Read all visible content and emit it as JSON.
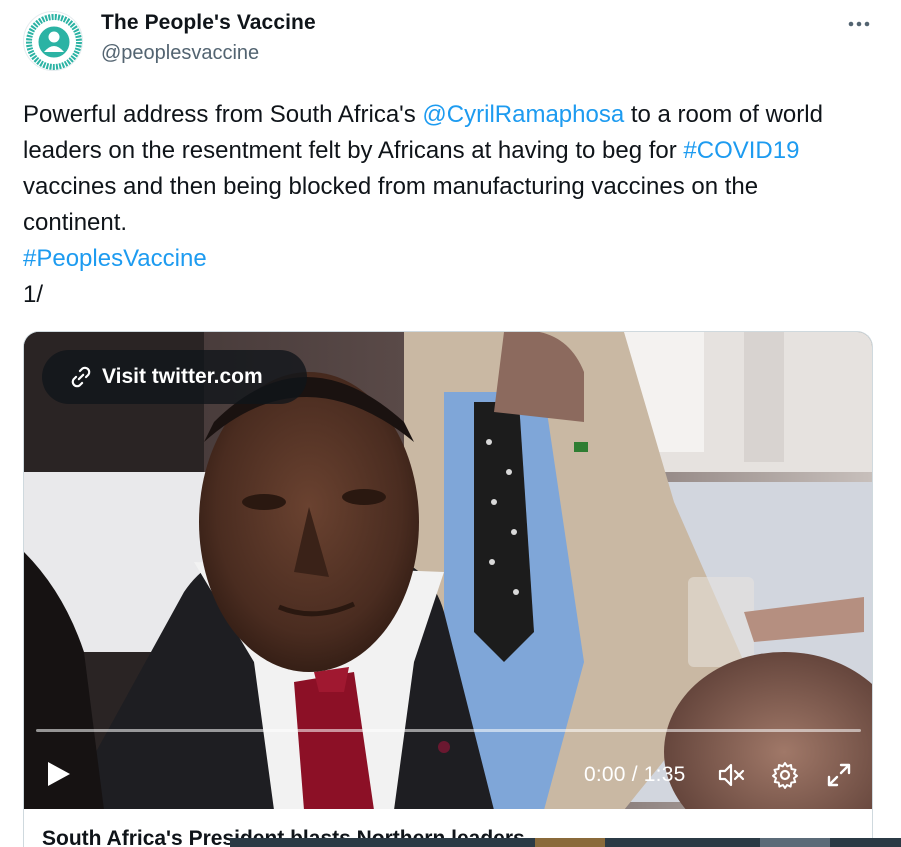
{
  "author": {
    "display_name": "The People's Vaccine",
    "handle": "@peoplesvaccine",
    "avatar_icon": "peoples-vaccine-logo-icon",
    "avatar_ring_text": "#PEOPLESVACCINE NOT A PROFIT VACCINE"
  },
  "more_icon": "more-horizontal-icon",
  "tweet": {
    "text_1": "Powerful address from South Africa's ",
    "mention": "@CyrilRamaphosa",
    "text_2": " to a room of world leaders on the resentment felt by Africans at having to beg for ",
    "hashtag_1": "#COVID19",
    "text_3": " vaccines and then being blocked from manufacturing vaccines on the continent.",
    "hashtag_2": "#PeoplesVaccine",
    "thread_marker": "1/"
  },
  "video": {
    "visit_label": "Visit twitter.com",
    "link_icon": "link-icon",
    "time_display": "0:00 / 1:35",
    "progress": 0,
    "play_icon": "play-icon",
    "mute_icon": "volume-muted-icon",
    "settings_icon": "gear-icon",
    "fullscreen_icon": "expand-icon"
  },
  "card": {
    "title": "South Africa's President blasts Northern leaders"
  },
  "colors": {
    "link": "#1d9bf0",
    "text": "#0f1419",
    "secondary": "#536471",
    "brand_teal": "#2bb3a4"
  }
}
